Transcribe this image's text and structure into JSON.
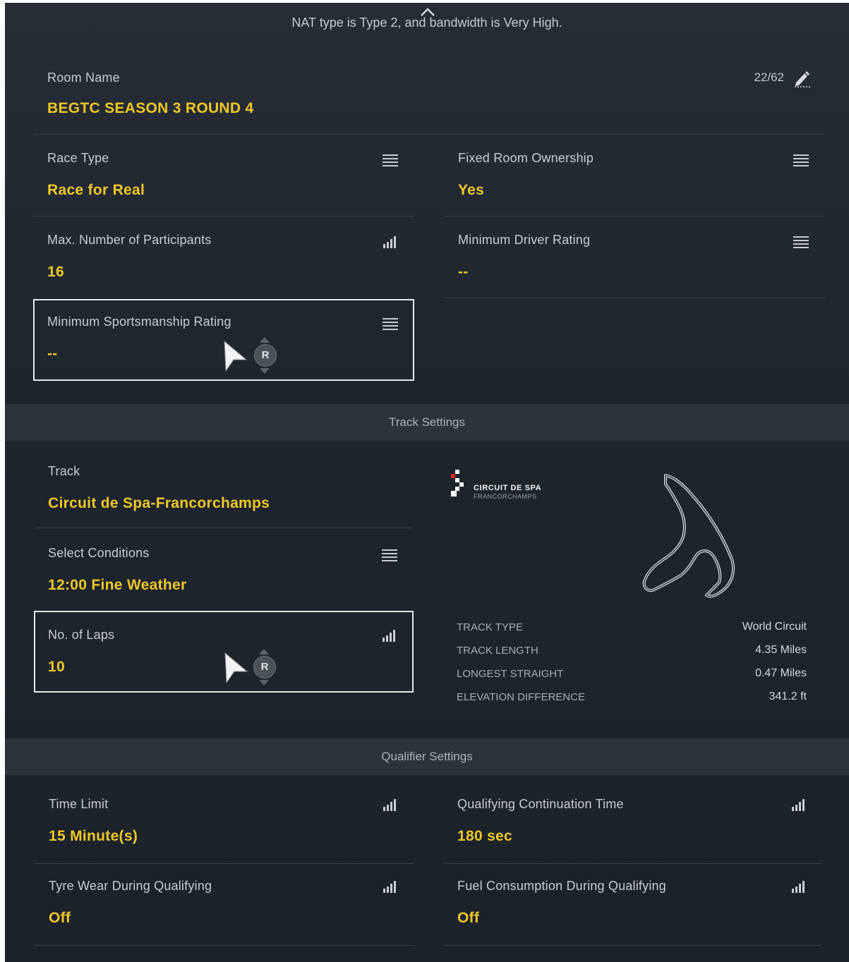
{
  "header": {
    "nat_status": "NAT type is Type 2, and bandwidth is Very High."
  },
  "room_name": {
    "label": "Room Name",
    "value": "BEGTC SEASON 3 ROUND 4",
    "counter": "22/62"
  },
  "room_settings": {
    "race_type": {
      "label": "Race Type",
      "value": "Race for Real"
    },
    "fixed_ownership": {
      "label": "Fixed Room Ownership",
      "value": "Yes"
    },
    "max_participants": {
      "label": "Max. Number of Participants",
      "value": "16"
    },
    "min_driver_rating": {
      "label": "Minimum Driver Rating",
      "value": "--"
    },
    "min_sportsmanship": {
      "label": "Minimum Sportsmanship Rating",
      "value": "--"
    }
  },
  "controller_hint": {
    "button": "R"
  },
  "track_settings": {
    "section_title": "Track Settings",
    "track": {
      "label": "Track",
      "value": "Circuit de Spa-Francorchamps"
    },
    "conditions": {
      "label": "Select Conditions",
      "value": "12:00 Fine Weather"
    },
    "laps": {
      "label": "No. of Laps",
      "value": "10"
    },
    "logo": {
      "line1": "CIRCUIT DE SPA",
      "line2": "FRANCORCHAMPS"
    },
    "specs": [
      {
        "key": "TRACK TYPE",
        "value": "World Circuit"
      },
      {
        "key": "TRACK LENGTH",
        "value": "4.35 Miles"
      },
      {
        "key": "LONGEST STRAIGHT",
        "value": "0.47 Miles"
      },
      {
        "key": "ELEVATION DIFFERENCE",
        "value": "341.2 ft"
      }
    ]
  },
  "qualifier_settings": {
    "section_title": "Qualifier Settings",
    "time_limit": {
      "label": "Time Limit",
      "value": "15 Minute(s)"
    },
    "continuation_time": {
      "label": "Qualifying Continuation Time",
      "value": "180 sec"
    },
    "tyre_wear": {
      "label": "Tyre Wear During Qualifying",
      "value": "Off"
    },
    "fuel_consumption": {
      "label": "Fuel Consumption During Qualifying",
      "value": "Off"
    }
  },
  "colors": {
    "accent": "#f1c821",
    "background": "#1f252d",
    "label": "#c9ccd1"
  }
}
